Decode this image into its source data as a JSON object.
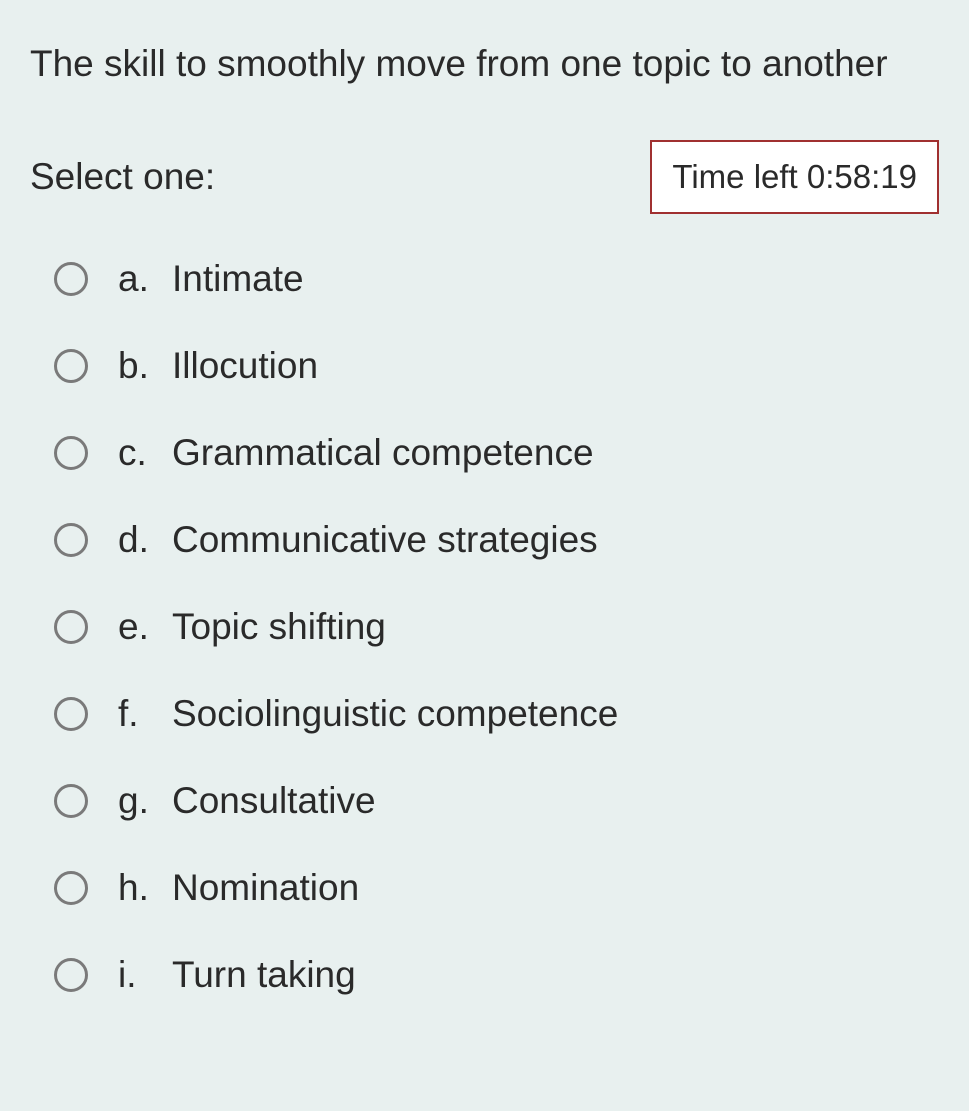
{
  "question": "The skill to smoothly move from one topic to another",
  "select_label": "Select one:",
  "timer_label": "Time left 0:58:19",
  "options": [
    {
      "letter": "a.",
      "text": "Intimate"
    },
    {
      "letter": "b.",
      "text": "Illocution"
    },
    {
      "letter": "c.",
      "text": "Grammatical competence"
    },
    {
      "letter": "d.",
      "text": "Communicative strategies"
    },
    {
      "letter": "e.",
      "text": "Topic shifting"
    },
    {
      "letter": "f.",
      "text": "Sociolinguistic competence"
    },
    {
      "letter": "g.",
      "text": "Consultative"
    },
    {
      "letter": "h.",
      "text": "Nomination"
    },
    {
      "letter": "i.",
      "text": "Turn taking"
    }
  ]
}
